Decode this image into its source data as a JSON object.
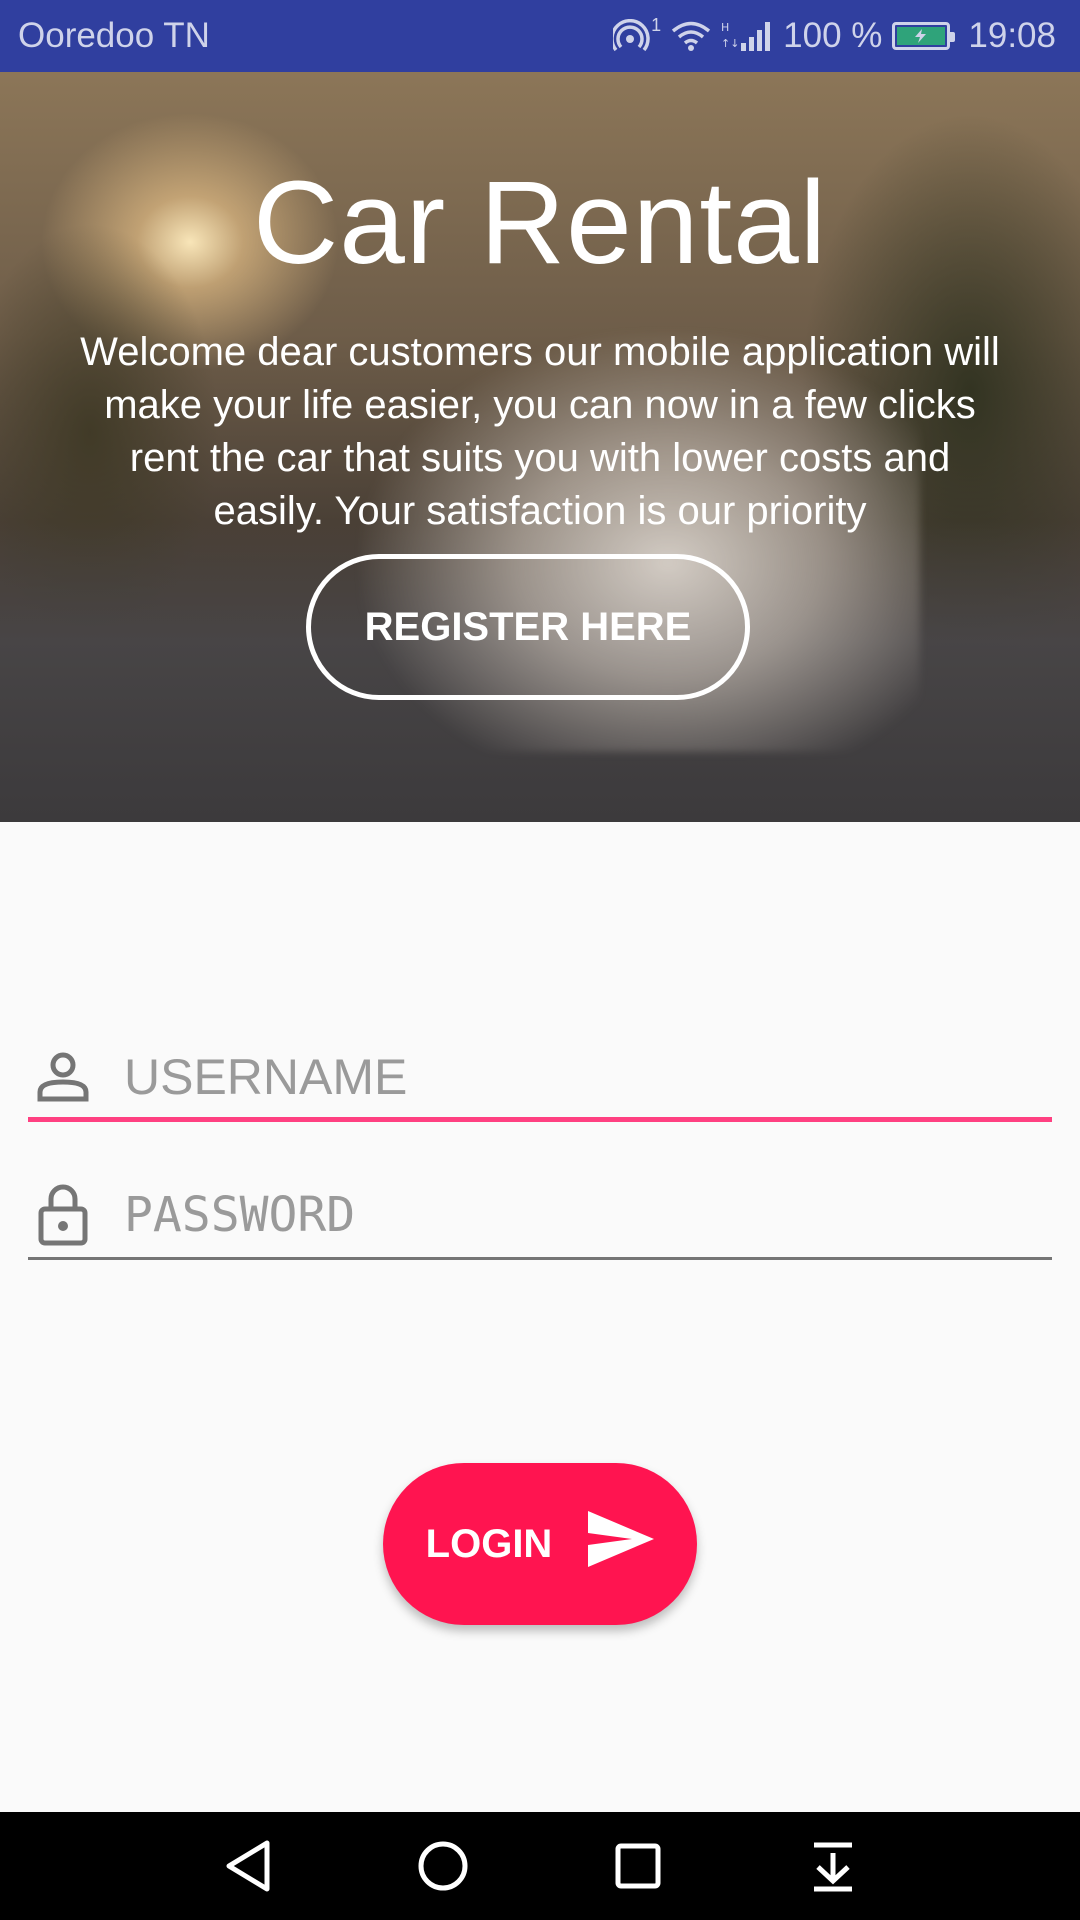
{
  "status_bar": {
    "carrier": "Ooredoo TN",
    "hotspot_count": "1",
    "battery": "100 %",
    "time": "19:08"
  },
  "hero": {
    "title": "Car Rental",
    "description": "Welcome dear customers our mobile application will make your life easier, you can now in a few clicks rent the car that suits you with lower costs and easily. Your satisfaction is our priority",
    "register_label": "REGISTER HERE"
  },
  "form": {
    "username_placeholder": "USERNAME",
    "password_placeholder": "PASSWORD",
    "login_label": "LOGIN",
    "accent_color": "#ff4081",
    "button_color": "#ff1450"
  },
  "icons": {
    "username": "person-icon",
    "password": "lock-icon",
    "login": "send-icon"
  },
  "nav_bar": [
    "back",
    "home",
    "recents",
    "notifications-pull"
  ]
}
